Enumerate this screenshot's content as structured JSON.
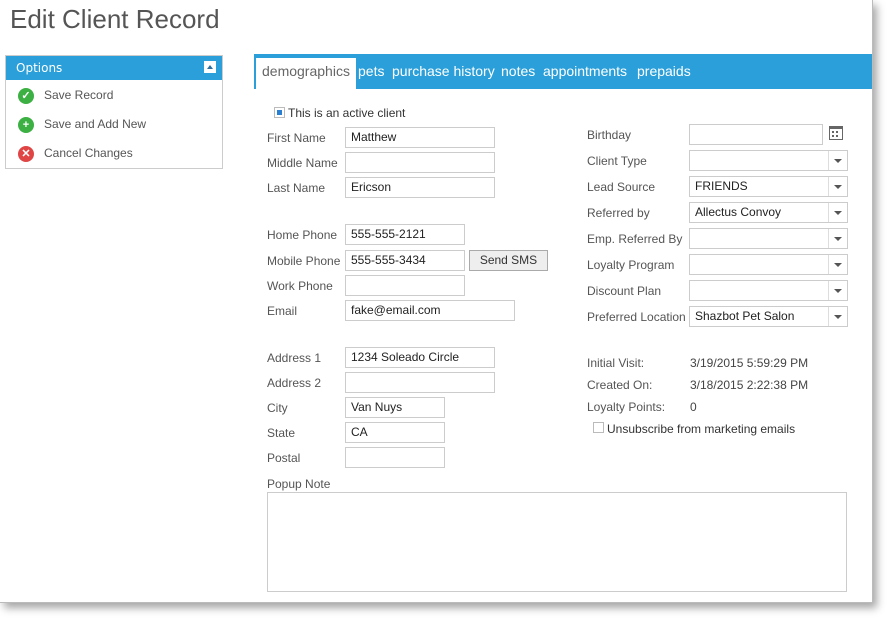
{
  "page": {
    "title": "Edit Client Record"
  },
  "options": {
    "header": "Options",
    "items": [
      {
        "label": "Save Record",
        "icon": "check-icon"
      },
      {
        "label": "Save and Add New",
        "icon": "plus-icon"
      },
      {
        "label": "Cancel Changes",
        "icon": "x-icon"
      }
    ]
  },
  "tabs": [
    {
      "label": "demographics",
      "active": true
    },
    {
      "label": "pets"
    },
    {
      "label": "purchase history"
    },
    {
      "label": "notes"
    },
    {
      "label": "appointments"
    },
    {
      "label": "prepaids"
    }
  ],
  "form": {
    "active_client": {
      "label": "This is an active client",
      "checked": true
    },
    "first_name": {
      "label": "First Name",
      "value": "Matthew"
    },
    "middle_name": {
      "label": "Middle Name",
      "value": ""
    },
    "last_name": {
      "label": "Last Name",
      "value": "Ericson"
    },
    "home_phone": {
      "label": "Home Phone",
      "value": "555-555-2121"
    },
    "mobile_phone": {
      "label": "Mobile Phone",
      "value": "555-555-3434"
    },
    "send_sms": "Send SMS",
    "work_phone": {
      "label": "Work Phone",
      "value": ""
    },
    "email": {
      "label": "Email",
      "value": "fake@email.com"
    },
    "address1": {
      "label": "Address 1",
      "value": "1234 Soleado Circle"
    },
    "address2": {
      "label": "Address 2",
      "value": ""
    },
    "city": {
      "label": "City",
      "value": "Van Nuys"
    },
    "state": {
      "label": "State",
      "value": "CA"
    },
    "postal": {
      "label": "Postal",
      "value": ""
    },
    "popup_note": {
      "label": "Popup Note",
      "value": ""
    },
    "birthday": {
      "label": "Birthday",
      "value": ""
    },
    "client_type": {
      "label": "Client Type",
      "value": ""
    },
    "lead_source": {
      "label": "Lead Source",
      "value": "FRIENDS"
    },
    "referred_by": {
      "label": "Referred by",
      "value": "Allectus Convoy"
    },
    "emp_referred_by": {
      "label": "Emp. Referred By",
      "value": ""
    },
    "loyalty_program": {
      "label": "Loyalty Program",
      "value": ""
    },
    "discount_plan": {
      "label": "Discount Plan",
      "value": ""
    },
    "preferred_location": {
      "label": "Preferred Location",
      "value": "Shazbot Pet Salon"
    },
    "initial_visit": {
      "label": "Initial Visit:",
      "value": "3/19/2015 5:59:29 PM"
    },
    "created_on": {
      "label": "Created On:",
      "value": "3/18/2015 2:22:38 PM"
    },
    "loyalty_points": {
      "label": "Loyalty Points:",
      "value": "0"
    },
    "unsubscribe": {
      "label": "Unsubscribe from marketing emails",
      "checked": false
    }
  },
  "colors": {
    "accent": "#2a9fd9"
  }
}
